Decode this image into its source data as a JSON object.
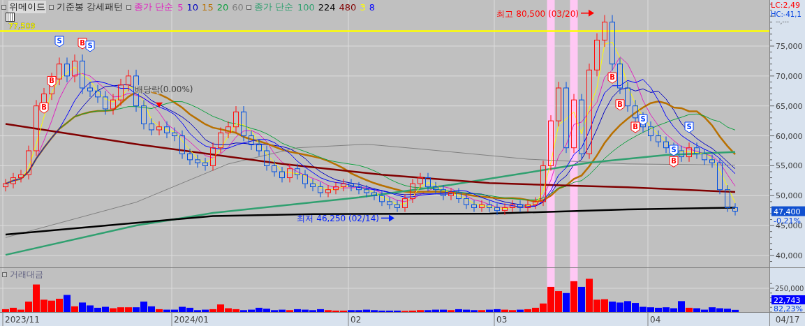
{
  "legend": [
    {
      "kind": "symbol",
      "label": "위메이드",
      "selected": true
    },
    {
      "kind": "indicator",
      "label": "기준봉 강세패턴",
      "selected": false
    },
    {
      "kind": "ma",
      "label": "종가 단순",
      "color": "#e020c0",
      "periods": [
        {
          "label": "5",
          "color": "#e020c0"
        },
        {
          "label": "10",
          "color": "#0000c0"
        },
        {
          "label": "15",
          "color": "#b87000"
        },
        {
          "label": "20",
          "color": "#10a040"
        },
        {
          "label": "60",
          "color": "#808080"
        }
      ]
    },
    {
      "kind": "ma",
      "label": "종가 단순",
      "color": "#30a070",
      "periods": [
        {
          "label": "100",
          "color": "#30a070"
        },
        {
          "label": "224",
          "color": "#000000"
        },
        {
          "label": "480",
          "color": "#800000"
        },
        {
          "label": "3",
          "color": "#ffff00"
        },
        {
          "label": "8",
          "color": "#0000ff"
        }
      ]
    }
  ],
  "price_chart": {
    "y_axis": [
      "75,000",
      "70,000",
      "65,000",
      "60,000",
      "55,000",
      "50,000",
      "45,000",
      "40,000"
    ],
    "level_label": "77,509",
    "high_label": "최고 80,500 (03/20)",
    "low_label": "최저 46,250 (02/14)",
    "ex_dividend_label": "배당락(0.00%)",
    "signals": [
      {
        "kind": "sell",
        "label": "S"
      },
      {
        "kind": "buy",
        "label": "B"
      },
      {
        "kind": "buy",
        "label": "B"
      },
      {
        "kind": "buy",
        "label": "B"
      },
      {
        "kind": "sell",
        "label": "S"
      },
      {
        "kind": "buy",
        "label": "B"
      },
      {
        "kind": "buy",
        "label": "B"
      },
      {
        "kind": "sell",
        "label": "S"
      },
      {
        "kind": "buy",
        "label": "B"
      },
      {
        "kind": "sell",
        "label": "S"
      },
      {
        "kind": "buy",
        "label": "B"
      },
      {
        "kind": "sell",
        "label": "S"
      }
    ],
    "lc": "LC:2,49",
    "hc": "HC:-41,1",
    "hc_sub": "--,---",
    "current_price": "47,400",
    "change": "-0,21%"
  },
  "volume_chart": {
    "title": "거래대금",
    "axis_label": "250,000",
    "current": "22,743",
    "ratio": "82,23%"
  },
  "x_axis": [
    "2023/11",
    "2024/01",
    "02",
    "03",
    "04"
  ],
  "last_date": "04/17"
}
